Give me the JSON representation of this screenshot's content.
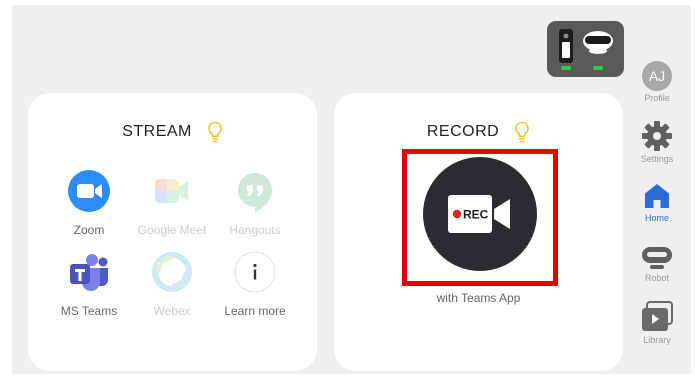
{
  "stream": {
    "title": "STREAM",
    "apps": [
      {
        "label": "Zoom",
        "icon": "zoom-icon",
        "enabled": true
      },
      {
        "label": "Google Meet",
        "icon": "google-meet-icon",
        "enabled": false
      },
      {
        "label": "Hangouts",
        "icon": "hangouts-icon",
        "enabled": false
      },
      {
        "label": "MS Teams",
        "icon": "ms-teams-icon",
        "enabled": true
      },
      {
        "label": "Webex",
        "icon": "webex-icon",
        "enabled": false
      },
      {
        "label": "Learn more",
        "icon": "info-icon",
        "enabled": true
      }
    ]
  },
  "record": {
    "title": "RECORD",
    "button_text": "REC",
    "subtitle": "with Teams App"
  },
  "nav": {
    "profile": {
      "initials": "AJ",
      "label": "Profile"
    },
    "settings": {
      "label": "Settings"
    },
    "home": {
      "label": "Home",
      "active": true
    },
    "robot": {
      "label": "Robot"
    },
    "library": {
      "label": "Library"
    }
  },
  "colors": {
    "accent": "#2d6bd6",
    "highlight": "#e60000",
    "bulb": "#f2c230",
    "battery": "#3ec63e"
  }
}
